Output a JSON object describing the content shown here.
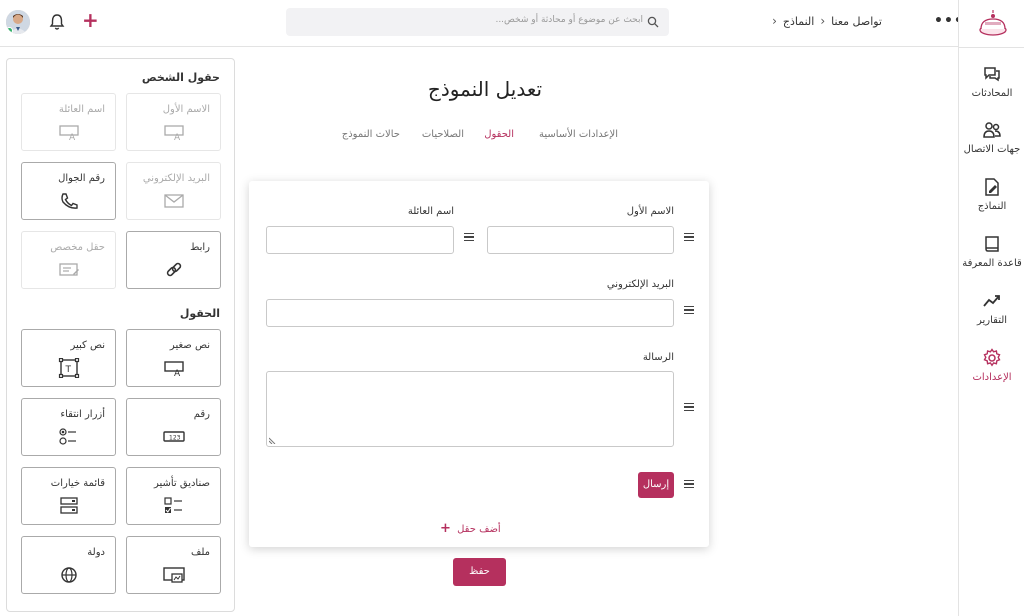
{
  "topbar": {
    "search_placeholder": "ابحث عن موضوع أو محادثة أو شخص...",
    "breadcrumb": [
      "تواصل معنا",
      "النماذج"
    ]
  },
  "sidebar": {
    "items": [
      {
        "label": "المحادثات",
        "icon": "chat-icon"
      },
      {
        "label": "جهات الاتصال",
        "icon": "contacts-icon"
      },
      {
        "label": "النماذج",
        "icon": "forms-icon"
      },
      {
        "label": "قاعدة المعرفة",
        "icon": "book-icon"
      },
      {
        "label": "التقارير",
        "icon": "chart-icon"
      },
      {
        "label": "الإعدادات",
        "icon": "gear-icon",
        "active": true
      }
    ]
  },
  "panel": {
    "person_fields_title": "حقول الشخص",
    "person_fields": [
      {
        "label": "الاسم الأول",
        "icon": "text-field-icon"
      },
      {
        "label": "اسم العائلة",
        "icon": "text-field-icon"
      },
      {
        "label": "البريد الإلكتروني",
        "icon": "envelope-icon"
      },
      {
        "label": "رقم الجوال",
        "icon": "phone-icon"
      },
      {
        "label": "رابط",
        "icon": "link-icon"
      },
      {
        "label": "حقل مخصص",
        "icon": "note-icon"
      }
    ],
    "fields_title": "الحقول",
    "fields": [
      {
        "label": "نص صغير",
        "icon": "small-text-icon"
      },
      {
        "label": "نص كبير",
        "icon": "big-text-icon"
      },
      {
        "label": "رقم",
        "icon": "number-icon"
      },
      {
        "label": "أزرار انتقاء",
        "icon": "radio-icon"
      },
      {
        "label": "صناديق تأشير",
        "icon": "checkbox-icon"
      },
      {
        "label": "قائمة خيارات",
        "icon": "dropdown-icon"
      },
      {
        "label": "ملف",
        "icon": "file-icon"
      },
      {
        "label": "دولة",
        "icon": "globe-icon"
      }
    ]
  },
  "main": {
    "title": "تعديل النموذج",
    "tabs": [
      "الإعدادات الأساسية",
      "الحقول",
      "الصلاحيات",
      "حالات النموذج"
    ],
    "active_tab": "الحقول",
    "form": {
      "first_name_label": "الاسم الأول",
      "last_name_label": "اسم العائلة",
      "email_label": "البريد الإلكتروني",
      "message_label": "الرسالة",
      "send_label": "إرسال",
      "add_field_label": "أضف حقل"
    },
    "save_label": "حفظ"
  },
  "colors": {
    "accent": "#b5305e"
  }
}
